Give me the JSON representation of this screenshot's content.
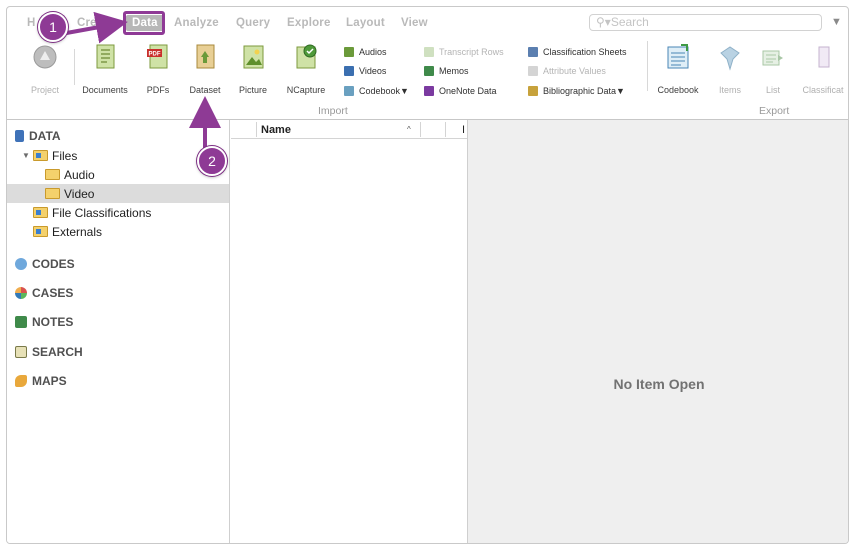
{
  "ribbon": {
    "tabs": [
      "H",
      "Cre",
      "Data",
      "Analyze",
      "Query",
      "Explore",
      "Layout",
      "View"
    ],
    "search_placeholder": "Search",
    "menu_glyph": "▼",
    "buttons": {
      "project": "Project",
      "documents": "Documents",
      "pdfs": "PDFs",
      "dataset": "Dataset",
      "picture": "Picture",
      "ncapture": "NCapture",
      "audios": "Audios",
      "videos": "Videos",
      "codebook_menu": "Codebook▼",
      "transcript_rows": "Transcript Rows",
      "memos": "Memos",
      "onenote_data": "OneNote Data",
      "classification_sheets": "Classification Sheets",
      "attribute_values": "Attribute Values",
      "bibliographic_data": "Bibliographic Data▼",
      "export_codebook": "Codebook",
      "items": "Items",
      "list": "List",
      "classifications": "Classificat"
    },
    "groups": {
      "import": "Import",
      "export": "Export"
    }
  },
  "nav": {
    "data": "DATA",
    "files": "Files",
    "audio": "Audio",
    "video": "Video",
    "file_classifications": "File Classifications",
    "externals": "Externals",
    "codes": "CODES",
    "cases": "CASES",
    "notes": "NOTES",
    "search": "SEARCH",
    "maps": "MAPS"
  },
  "list": {
    "name_header": "Name",
    "sort_glyph": "^",
    "cut_header": "I"
  },
  "detail": {
    "empty_message": "No Item Open"
  },
  "callouts": {
    "one": "1",
    "two": "2"
  },
  "colors": {
    "callout": "#8e3a95",
    "ribbon_active_tab": "#b7b7b7"
  }
}
